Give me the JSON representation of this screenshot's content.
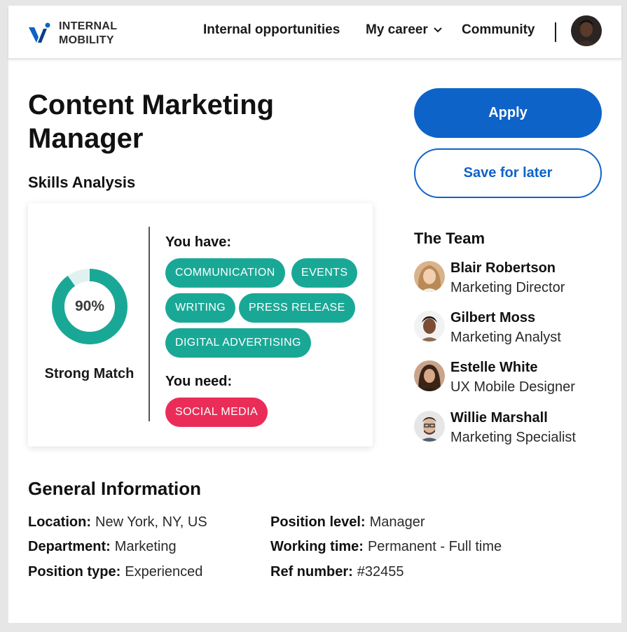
{
  "header": {
    "logo_line1": "INTERNAL",
    "logo_line2": "MOBILITY",
    "nav": {
      "internal_opportunities": "Internal opportunities",
      "my_career": "My career",
      "community": "Community"
    },
    "brand_color": "#0d63c8"
  },
  "job": {
    "title": "Content Marketing Manager"
  },
  "skills": {
    "section_title": "Skills Analysis",
    "match_percent_label": "90%",
    "match_fraction": 0.9,
    "match_label": "Strong Match",
    "have_title": "You have:",
    "have": [
      "COMMUNICATION",
      "EVENTS",
      "WRITING",
      "PRESS RELEASE",
      "DIGITAL ADVERTISING"
    ],
    "need_title": "You need:",
    "need": [
      "SOCIAL MEDIA"
    ],
    "have_color": "#1aa896",
    "need_color": "#ea2d58"
  },
  "actions": {
    "apply": "Apply",
    "save": "Save for later"
  },
  "team": {
    "title": "The Team",
    "members": [
      {
        "name": "Blair Robertson",
        "role": "Marketing Director"
      },
      {
        "name": "Gilbert Moss",
        "role": "Marketing Analyst"
      },
      {
        "name": "Estelle White",
        "role": "UX Mobile Designer"
      },
      {
        "name": "Willie Marshall",
        "role": "Marketing Specialist"
      }
    ]
  },
  "general": {
    "title": "General Information",
    "location_label": "Location:",
    "location": "New York, NY, US",
    "department_label": "Department:",
    "department": "Marketing",
    "position_type_label": "Position type:",
    "position_type": "Experienced",
    "position_level_label": "Position level:",
    "position_level": "Manager",
    "working_time_label": "Working time:",
    "working_time": "Permanent - Full time",
    "ref_label": "Ref number:",
    "ref": "#32455"
  }
}
